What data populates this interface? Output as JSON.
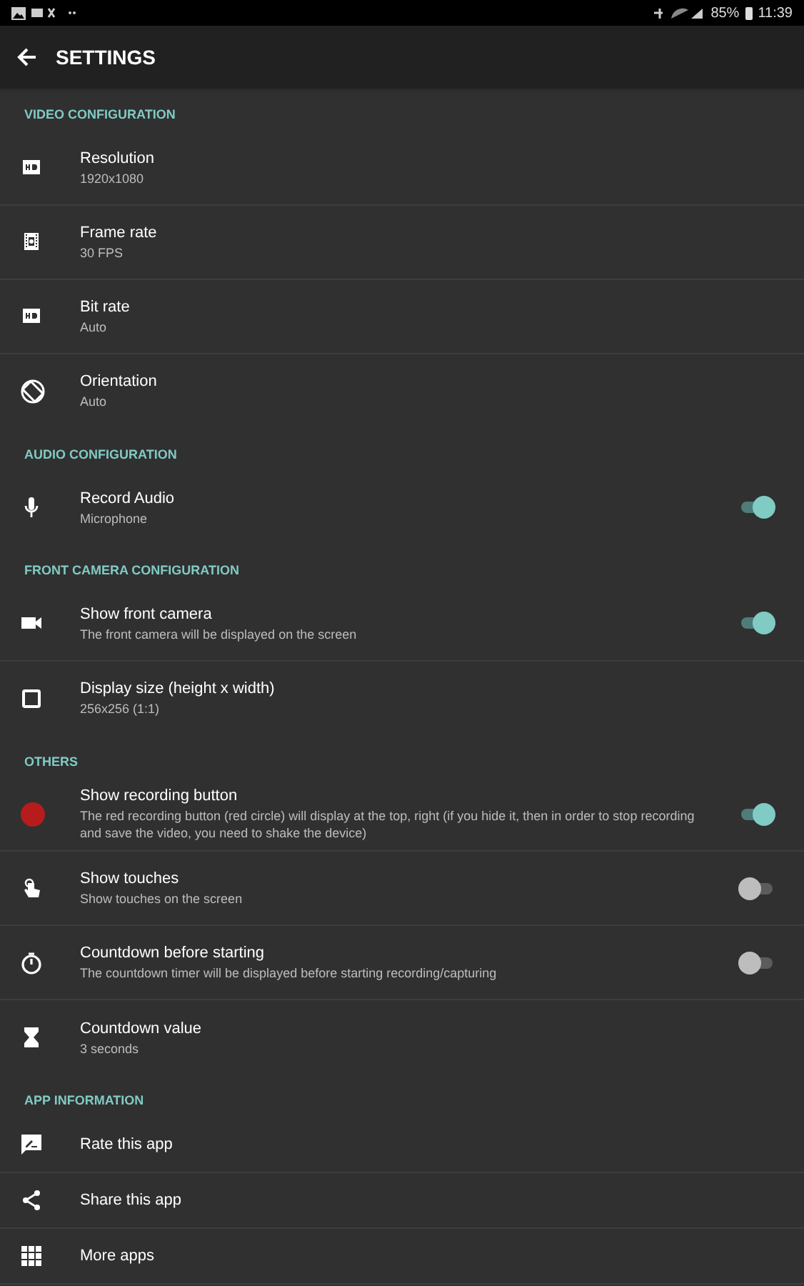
{
  "status_bar": {
    "battery": "85%",
    "time": "11:39"
  },
  "toolbar": {
    "title": "SETTINGS"
  },
  "sections": [
    {
      "header": "VIDEO CONFIGURATION",
      "items": [
        {
          "title": "Resolution",
          "subtitle": "1920x1080"
        },
        {
          "title": "Frame rate",
          "subtitle": "30 FPS"
        },
        {
          "title": "Bit rate",
          "subtitle": "Auto"
        },
        {
          "title": "Orientation",
          "subtitle": "Auto"
        }
      ]
    },
    {
      "header": "AUDIO CONFIGURATION",
      "items": [
        {
          "title": "Record Audio",
          "subtitle": "Microphone",
          "on": true
        }
      ]
    },
    {
      "header": "FRONT CAMERA CONFIGURATION",
      "items": [
        {
          "title": "Show front camera",
          "subtitle": "The front camera will be displayed on the screen",
          "on": true
        },
        {
          "title": "Display size (height x width)",
          "subtitle": "256x256 (1:1)"
        }
      ]
    },
    {
      "header": "OTHERS",
      "items": [
        {
          "title": "Show recording button",
          "subtitle": "The red recording button (red circle) will display at the top, right (if you hide it, then in order to stop recording and save the video, you need to shake the device)",
          "on": true
        },
        {
          "title": "Show touches",
          "subtitle": "Show touches on the screen",
          "on": false
        },
        {
          "title": "Countdown before starting",
          "subtitle": "The countdown timer will be displayed before starting recording/capturing",
          "on": false
        },
        {
          "title": "Countdown value",
          "subtitle": "3 seconds"
        }
      ]
    },
    {
      "header": "APP INFORMATION",
      "items": [
        {
          "title": "Rate this app"
        },
        {
          "title": "Share this app"
        },
        {
          "title": "More apps"
        }
      ]
    }
  ]
}
